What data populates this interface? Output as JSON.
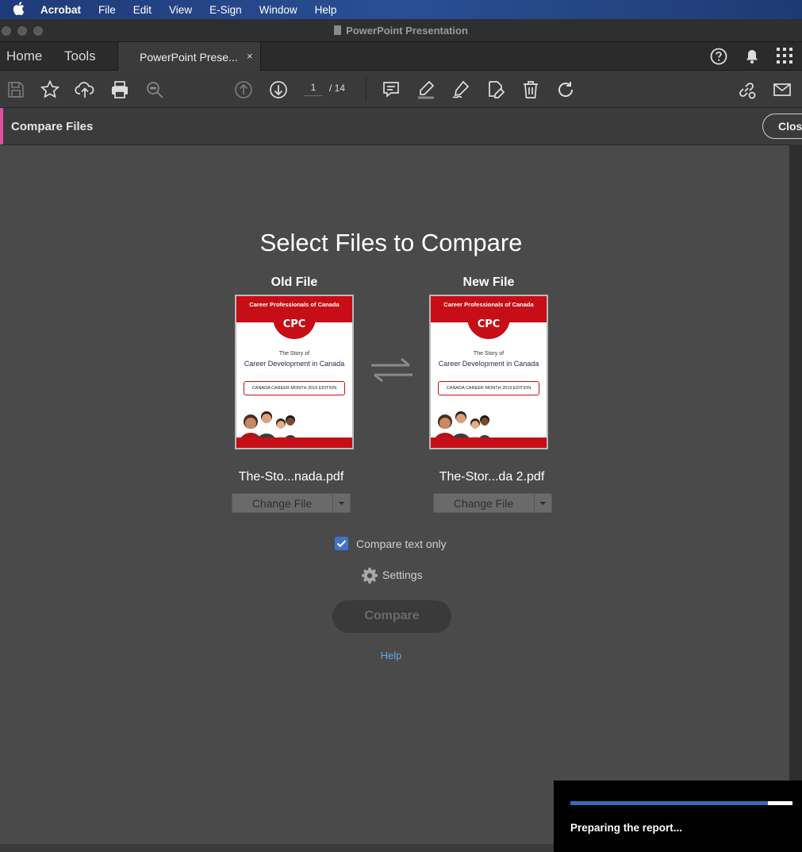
{
  "menubar": {
    "items": [
      "Acrobat",
      "File",
      "Edit",
      "View",
      "E-Sign",
      "Window",
      "Help"
    ]
  },
  "window": {
    "title": "PowerPoint Presentation"
  },
  "tabs": {
    "home": "Home",
    "tools": "Tools",
    "document": "PowerPoint Prese...",
    "close_glyph": "×"
  },
  "toolbar": {
    "current_page": "1",
    "total_pages": "/ 14"
  },
  "tool_panel": {
    "title": "Compare Files",
    "close_label": "Clos",
    "accent_color": "#e04fa0"
  },
  "compare": {
    "headline": "Select Files to Compare",
    "old": {
      "label": "Old File",
      "filename": "The-Sto...nada.pdf",
      "change_label": "Change File"
    },
    "new": {
      "label": "New File",
      "filename": "The-Stor...da 2.pdf",
      "change_label": "Change File"
    },
    "cover": {
      "org": "Career Professionals of Canada",
      "seal": "CPC",
      "story": "The Story of",
      "subtitle": "Career Development in Canada",
      "badge": "CANADA CAREER MONTH 2019 EDITION"
    },
    "text_only_label": "Compare text only",
    "text_only_checked": true,
    "settings_label": "Settings",
    "compare_button": "Compare",
    "help_link": "Help"
  },
  "toast": {
    "message": "Preparing the report...",
    "progress": 0.89
  }
}
